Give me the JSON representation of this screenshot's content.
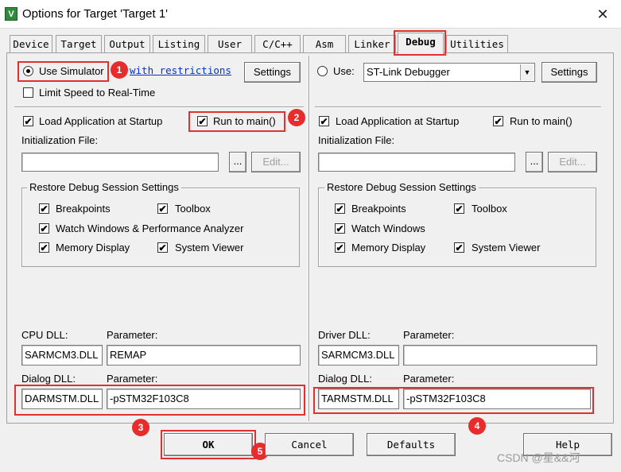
{
  "window": {
    "title": "Options for Target 'Target 1'",
    "app_icon_glyph": "V",
    "close_glyph": "✕"
  },
  "tabs": [
    {
      "label": "Device"
    },
    {
      "label": "Target"
    },
    {
      "label": "Output"
    },
    {
      "label": "Listing"
    },
    {
      "label": "User"
    },
    {
      "label": "C/C++"
    },
    {
      "label": "Asm"
    },
    {
      "label": "Linker"
    },
    {
      "label": "Debug",
      "active": true
    },
    {
      "label": "Utilities"
    }
  ],
  "left": {
    "use_simulator": "Use Simulator",
    "with_restrictions": "with restrictions",
    "settings": "Settings",
    "limit_speed": "Limit Speed to Real-Time",
    "load_app": "Load Application at Startup",
    "run_to_main": "Run to main()",
    "init_file": "Initialization File:",
    "browse": "...",
    "edit": "Edit...",
    "restore_title": "Restore Debug Session Settings",
    "breakpoints": "Breakpoints",
    "toolbox": "Toolbox",
    "watch_windows": "Watch Windows & Performance Analyzer",
    "memory_display": "Memory Display",
    "system_viewer": "System Viewer",
    "cpu_dll_label": "CPU DLL:",
    "parameter_label": "Parameter:",
    "cpu_dll": "SARMCM3.DLL",
    "cpu_param": "REMAP",
    "dialog_dll_label": "Dialog DLL:",
    "dialog_dll": "DARMSTM.DLL",
    "dialog_param": "-pSTM32F103C8"
  },
  "right": {
    "use": "Use:",
    "debugger": "ST-Link Debugger",
    "settings": "Settings",
    "load_app": "Load Application at Startup",
    "run_to_main": "Run to main()",
    "init_file": "Initialization File:",
    "browse": "...",
    "edit": "Edit...",
    "restore_title": "Restore Debug Session Settings",
    "breakpoints": "Breakpoints",
    "toolbox": "Toolbox",
    "watch_windows": "Watch Windows",
    "memory_display": "Memory Display",
    "system_viewer": "System Viewer",
    "driver_dll_label": "Driver DLL:",
    "parameter_label": "Parameter:",
    "driver_dll": "SARMCM3.DLL",
    "driver_param": "",
    "dialog_dll_label": "Dialog DLL:",
    "dialog_dll": "TARMSTM.DLL",
    "dialog_param": "-pSTM32F103C8"
  },
  "buttons": {
    "ok": "OK",
    "cancel": "Cancel",
    "defaults": "Defaults",
    "help": "Help"
  },
  "badges": [
    "1",
    "2",
    "3",
    "4",
    "5"
  ],
  "watermark": "CSDN @星&&河",
  "check_glyph": "✔",
  "dropdown_glyph": "▼",
  "colors": {
    "highlight": "#e03030",
    "badge": "#e62c2c",
    "link": "#0033cc"
  }
}
